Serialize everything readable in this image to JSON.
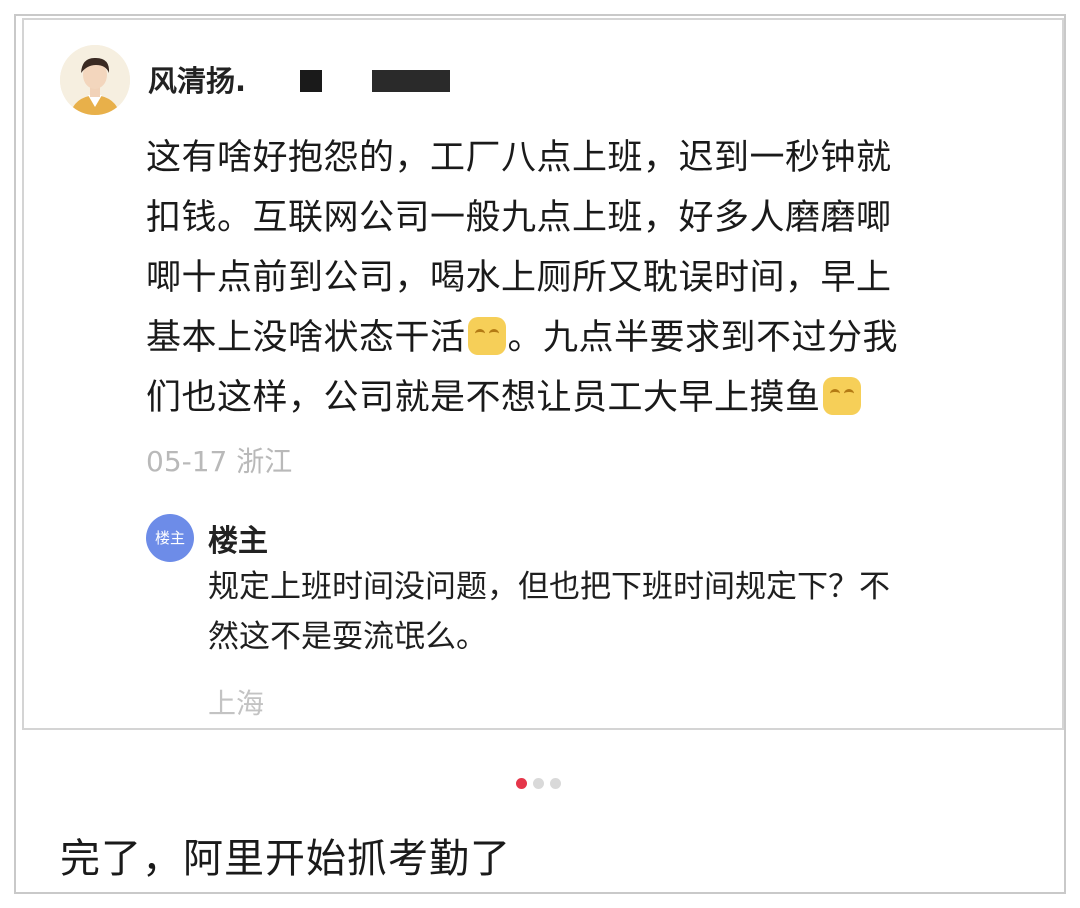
{
  "post": {
    "username": "风清扬.",
    "text_lines": [
      "这有啥好抱怨的，工厂八点上班，迟到一秒钟就",
      "扣钱。互联网公司一般九点上班，好多人磨磨唧",
      "唧十点前到公司，喝水上厕所又耽误时间，早上"
    ],
    "line4_before": "基本上没啥状态干活",
    "line4_after": "。九点半要求到不过分我",
    "line5_before": "们也这样，公司就是不想让员工大早上摸鱼",
    "date": "05-17",
    "location": "浙江",
    "emoji_name": "smirk-emoji"
  },
  "reply": {
    "avatar_label": "楼主",
    "name": "楼主",
    "text_lines": [
      "规定上班时间没问题，但也把下班时间规定下？不",
      "然这不是耍流氓么。"
    ],
    "location": "上海"
  },
  "pager": {
    "total": 3,
    "active_index": 0
  },
  "caption": "完了，阿里开始抓考勤了",
  "colors": {
    "active_dot": "#e5364a",
    "reply_avatar": "#6d8ce8",
    "meta_text": "#b9b9b9"
  }
}
